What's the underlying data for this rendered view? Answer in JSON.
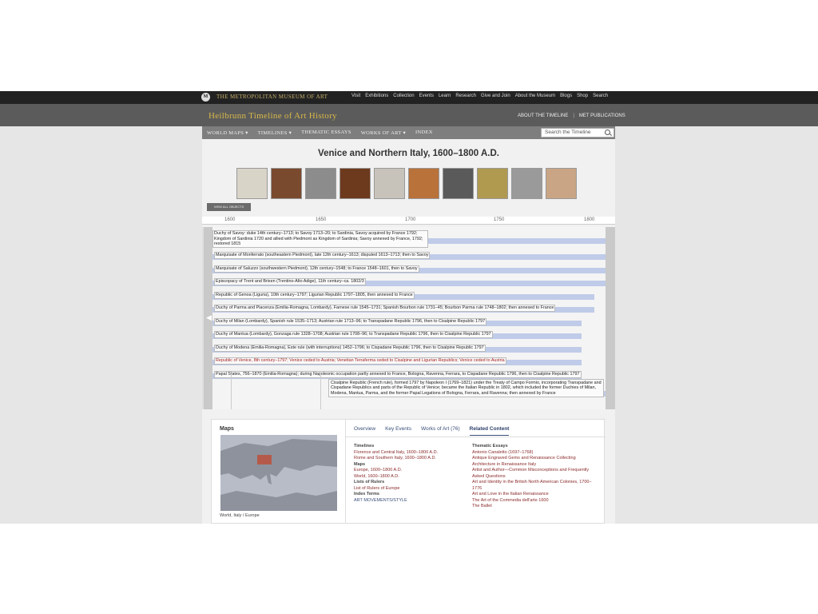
{
  "met": {
    "logo": "M",
    "name": "THE METROPOLITAN MUSEUM OF ART",
    "nav": [
      "Visit",
      "Exhibitions",
      "Collection",
      "Events",
      "Learn",
      "Research",
      "Give and Join",
      "About the Museum",
      "Blogs",
      "Shop",
      "Search"
    ]
  },
  "header": {
    "title": "Heilbrunn Timeline of Art History",
    "links": [
      "ABOUT THE TIMELINE",
      "|",
      "MET PUBLICATIONS"
    ]
  },
  "nav": {
    "items": [
      "WORLD MAPS ▾",
      "TIMELINES ▾",
      "THEMATIC ESSAYS",
      "WORKS OF ART ▾",
      "INDEX"
    ],
    "search_placeholder": "Search the Timeline"
  },
  "page": {
    "title": "Venice and Northern Italy, 1600–1800 A.D.",
    "view_all": "VIEW ALL OBJECTS",
    "thumb_colors": [
      "#d9d4c8",
      "#7a4a2e",
      "#8c8c8c",
      "#6d3a1e",
      "#c8c3ba",
      "#b9723a",
      "#5a5a5a",
      "#b09a50",
      "#9a9a9a",
      "#c9a585"
    ]
  },
  "axis": {
    "ticks": [
      "1600",
      "1650",
      "1700",
      "1750",
      "1800"
    ]
  },
  "timeline": {
    "first_label": "Duchy of Savoy: duke 14th century–1713; to Savoy 1713–20; to Sardinia, Savoy acquired by France 1792; Kingdom of Sardinia 1720 and allied with Piedmont as Kingdom of Sardinia; Savoy annexed by France, 1792; restored 1815",
    "rows": [
      {
        "text": "Marquisate of Monferrato (southeastern Piedmont), late 12th century–1613; disputed 1613–1713; then to Savoy",
        "red": false
      },
      {
        "text": "Marquisate of Saluzzo (southwestern Piedmont), 12th century–1548; to France 1548–1601, then to Savoy",
        "red": false
      },
      {
        "text": "Episcopacy of Trent and Brixen (Trentino-Alto Adige), 11th century–ca. 1802/3",
        "red": false
      },
      {
        "text": "Republic of Genoa (Liguria), 10th century–1797; Ligurian Republic 1797–1805, then annexed to France",
        "red": false
      },
      {
        "text": "Duchy of Parma and Piacenza (Emilia-Romagna, Lombardy), Farnese rule 1545–1731; Spanish Bourbon rule 1731–45; Bourbon Parma rule 1748–1802; then annexed to France",
        "red": false
      },
      {
        "text": "Duchy of Milan (Lombardy), Spanish rule 1535–1713; Austrian rule 1713–96; to Transpadane Republic 1796, then to Cisalpine Republic 1797",
        "red": false
      },
      {
        "text": "Duchy of Mantua (Lombardy), Gonzaga rule 1328–1708; Austrian rule 1708–96; to Transpadane Republic 1796, then to Cisalpine Republic 1797",
        "red": false
      },
      {
        "text": "Duchy of Modena (Emilia-Romagna), Este rule (with interruptions) 1452–1796; to Cispadane Republic 1796, then to Cisalpine Republic 1797",
        "red": false
      },
      {
        "text": "Republic of Venice, 8th century–1797; Venice ceded to Austria; Venetian Terraferma ceded to Cisalpine and Ligurian Republics; Venice ceded to Austria",
        "red": true
      },
      {
        "text": "Papal States, 756–1870 (Emilia-Romagna); during Napoleonic occupation partly annexed to France, Bologna, Ravenna, Ferrara, to Cispadane Republic 1796, then to Cisalpine Republic 1797",
        "red": false
      }
    ],
    "footer_label": "Cisalpine Republic (French rule), formed 1797 by Napoleon I (1769–1821) under the Treaty of Campo Formio, incorporating Transpadane and Cispadane Republics and parts of the Republic of Venice; became the Italian Republic in 1802, which included the former Duchies of Milan, Modena, Mantua, Parma, and the former Papal Legations of Bologna, Ferrara, and Ravenna; then annexed by France"
  },
  "maps": {
    "title": "Maps",
    "caption": "World, Italy / Europe"
  },
  "tabs": [
    "Overview",
    "Key Events",
    "Works of Art (76)",
    "Related Content"
  ],
  "related": {
    "timelines_title": "Timelines",
    "timelines": [
      "Florence and Central Italy, 1600–1800 A.D.",
      "Rome and Southern Italy, 1600–1800 A.D."
    ],
    "maps_title": "Maps",
    "maps": [
      "Europe, 1600–1800 A.D.",
      "World, 1600–1800 A.D."
    ],
    "rulers_title": "Lists of Rulers",
    "rulers": [
      "List of Rulers of Europe"
    ],
    "index_title": "Index Terms",
    "index": [
      "ART MOVEMENTS/STYLE"
    ],
    "essays_title": "Thematic Essays",
    "essays": [
      "Antonio Canaletto (1697–1768)",
      "Antique Engraved Gems and Renaissance Collecting",
      "Architecture in Renaissance Italy",
      "Artist and Author—Common Misconceptions and Frequently Asked Questions",
      "Art and Identity in the British North American Colonies, 1700–1776",
      "Art and Love in the Italian Renaissance",
      "The Art of the Commedia dell'arte 1600",
      "The Ballet"
    ]
  }
}
